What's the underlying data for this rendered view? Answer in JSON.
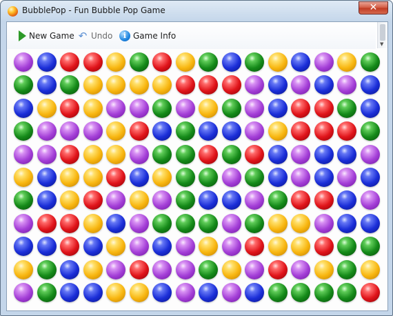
{
  "window": {
    "title": "BubblePop - Fun Bubble Pop Game",
    "close_glyph": "✕"
  },
  "toolbar": {
    "new_game": {
      "label": "New Game",
      "icon": "play-icon",
      "enabled": true
    },
    "undo": {
      "label": "Undo",
      "icon": "undo-icon",
      "enabled": false,
      "glyph": "↶"
    },
    "game_info": {
      "label": "Game Info",
      "icon": "info-icon",
      "enabled": true,
      "glyph": "i"
    }
  },
  "board": {
    "columns": 16,
    "rows": 11,
    "colors": {
      "P": "purple",
      "B": "blue",
      "R": "red",
      "Y": "yellow",
      "G": "green"
    },
    "grid": [
      "PBRRYGRYGBGYBPYG",
      "GBGYYYYRRRPBPBPB",
      "BYRYPPGPYGPBRRGB",
      "GPPPYRBGBBPYRRRG",
      "PPRYYPGGRGRBPBBP",
      "YBYYRBYGGPGBPBPB",
      "GBYRPYPGBBPGRRBP",
      "PRRYBPGGGPGYYPBB",
      "BBRBYPBPYPRYYRGG",
      "YGBYPRPPGYPRPYGY",
      "PGBBYYBPBPBGGGGR"
    ]
  }
}
